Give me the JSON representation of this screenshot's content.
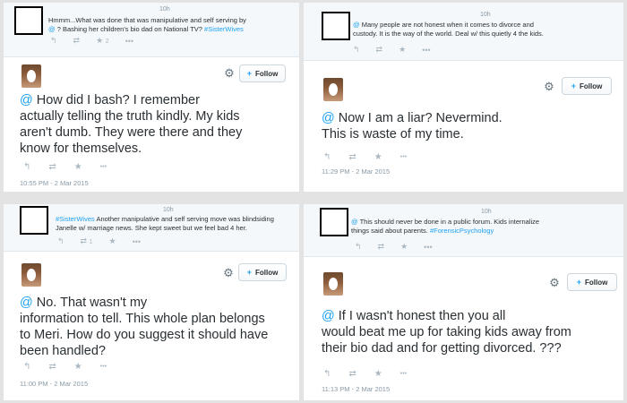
{
  "panels": [
    {
      "reply": {
        "time": "10h",
        "text_line1": "Hmmm...What was done that was manipulative and self serving by",
        "mention": "@",
        "text_line2": "? Bashing her children's bio dad on National TV?",
        "hashtag": "#SisterWives",
        "retweet_count": "",
        "like_count": "2"
      },
      "follow_label": "Follow",
      "mention": "@",
      "text": "How did I bash? I remember\nactually telling the truth kindly.  My kids\naren't dumb. They were there and they\nknow for themselves.",
      "timestamp": "10:55 PM - 2 Mar 2015"
    },
    {
      "reply": {
        "time": "10h",
        "mention": "@",
        "text_line1": "Many people are not honest when it comes to divorce and",
        "text_line2": "custody.  It is the way of the world.  Deal w/ this quietly 4 the kids.",
        "hashtag": "",
        "retweet_count": "",
        "like_count": ""
      },
      "follow_label": "Follow",
      "mention": "@",
      "text": "Now I am a liar?  Nevermind.\nThis is waste of my time.",
      "timestamp": "11:29 PM - 2 Mar 2015"
    },
    {
      "reply": {
        "time": "10h",
        "hashtag": "#SisterWives",
        "text_line1": "Another manipulative and self serving move was blindsiding",
        "text_line2": "Janelle w/ marriage news. She kept sweet but we feel bad 4 her.",
        "mention": "",
        "retweet_count": "1",
        "like_count": ""
      },
      "follow_label": "Follow",
      "mention": "@",
      "text": "No.  That wasn't my\ninformation to tell.  This whole plan belongs\nto Meri.  How do you suggest it should have\nbeen handled?",
      "timestamp": "11:00 PM - 2 Mar 2015"
    },
    {
      "reply": {
        "time": "10h",
        "mention": "@",
        "text_line1": "This should never be done in a public forum.  Kids internalize",
        "text_line2": "things said about parents.",
        "hashtag": "#ForensicPsychology",
        "retweet_count": "",
        "like_count": ""
      },
      "follow_label": "Follow",
      "mention": "@",
      "text": "If I wasn't honest then you all\nwould beat me up for taking kids away from\ntheir bio dad and for getting divorced. ???",
      "timestamp": "11:13 PM - 2 Mar 2015"
    }
  ],
  "icons": {
    "reply": "↰",
    "retweet": "⇄",
    "like": "★",
    "more": "•••",
    "gear": "⚙",
    "follow_plus": "+👤"
  },
  "colors": {
    "accent": "#1da1f2",
    "muted": "#8899a6",
    "icon": "#aab8c2"
  }
}
